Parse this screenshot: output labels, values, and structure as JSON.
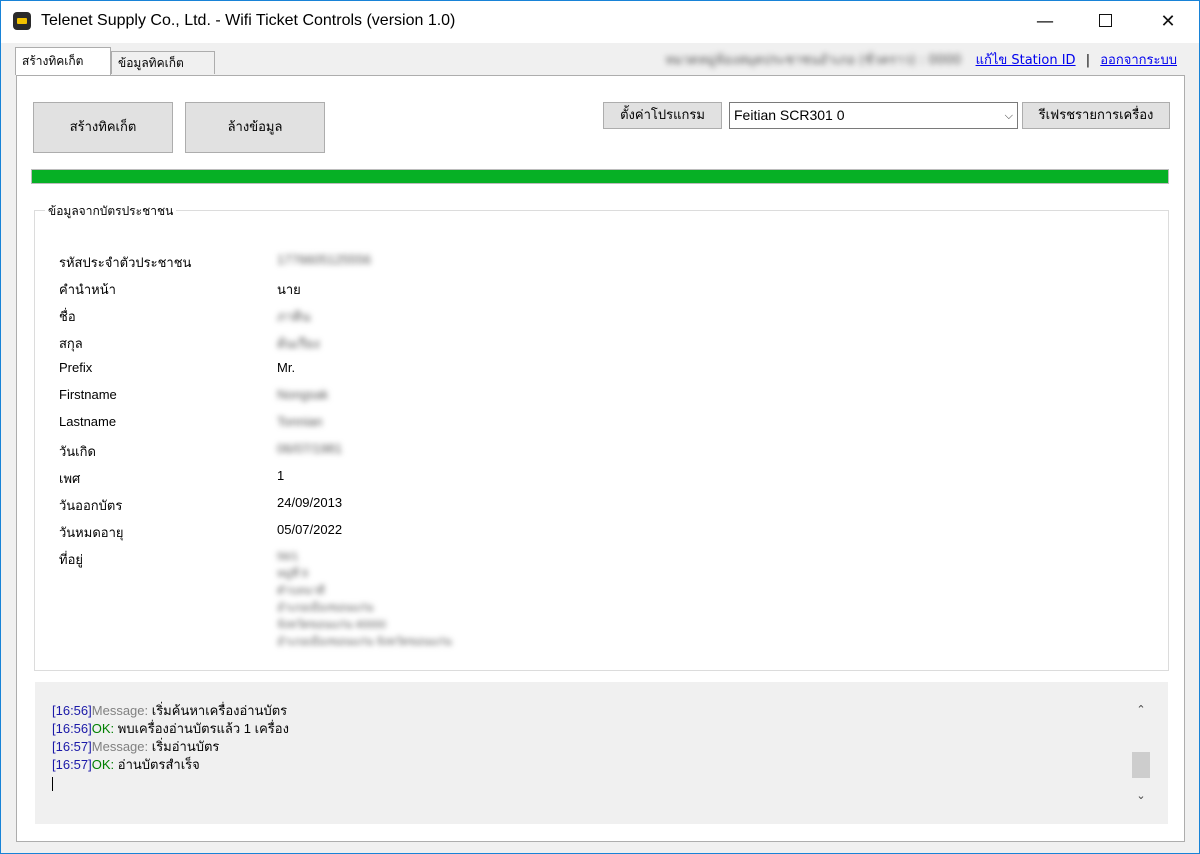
{
  "window": {
    "title": "Telenet Supply Co., Ltd. - Wifi Ticket Controls (version 1.0)",
    "icon": "card-reader-icon",
    "controls": {
      "minimize": "—",
      "maximize": "",
      "close": "✕"
    }
  },
  "tabs": [
    {
      "label": "สร้างทิคเก็ต",
      "active": true
    },
    {
      "label": "ข้อมูลทิคเก็ต",
      "active": false
    }
  ],
  "top_links": {
    "station_name": "หมวดหมู่ห้องสมุดประชาชนอำเภอ (ชั่วคราว) : 0000",
    "edit_station": "แก้ไข Station ID",
    "separator": "|",
    "logout": "ออกจากระบบ"
  },
  "actions": {
    "create_ticket": "สร้างทิคเก็ต",
    "clear_data": "ล้างข้อมูล",
    "program_settings": "ตั้งค่าโปรแกรม",
    "refresh_devices": "รีเฟรชรายการเครื่อง"
  },
  "reader_select": {
    "value": "Feitian SCR301 0",
    "arrow": "⌵"
  },
  "progress": {
    "fraction": 1.0,
    "color": "#06b025"
  },
  "card_info": {
    "title": "ข้อมูลจากบัตรประชาชน",
    "fields": [
      {
        "label": "รหัสประจำตัวประชาชน",
        "value": "1776605125556",
        "blurred": true
      },
      {
        "label": "คำนำหน้า",
        "value": "นาย",
        "blurred": false
      },
      {
        "label": "ชื่อ",
        "value": "ภาคิน",
        "blurred": true
      },
      {
        "label": "สกุล",
        "value": "ต้นเรียง",
        "blurred": true
      },
      {
        "label": "Prefix",
        "value": "Mr.",
        "blurred": false
      },
      {
        "label": "Firstname",
        "value": "Nongsak",
        "blurred": true
      },
      {
        "label": "Lastname",
        "value": "Tonnian",
        "blurred": true
      },
      {
        "label": "วันเกิด",
        "value": "06/07/1981",
        "blurred": true
      },
      {
        "label": "เพศ",
        "value": "1",
        "blurred": false
      },
      {
        "label": "วันออกบัตร",
        "value": "24/09/2013",
        "blurred": false
      },
      {
        "label": "วันหมดอายุ",
        "value": "05/07/2022",
        "blurred": false
      },
      {
        "label": "ที่อยู่",
        "value": "",
        "blurred": false
      }
    ],
    "address_lines": [
      "56/1",
      "หมู่ที่ 9",
      "ตำบลนาดี",
      "อำเภอเมืองขอนแก่น",
      "จังหวัดขอนแก่น 40000",
      "อำเภอเมืองขอนแก่น จังหวัดขอนแก่น"
    ]
  },
  "log": [
    {
      "time": "[16:56]",
      "type": "Message:",
      "kind": "msg",
      "text": " เริ่มค้นหาเครื่องอ่านบัตร"
    },
    {
      "time": "[16:56]",
      "type": "OK:",
      "kind": "ok",
      "text": " พบเครื่องอ่านบัตรแล้ว 1 เครื่อง"
    },
    {
      "time": "[16:57]",
      "type": "Message:",
      "kind": "msg",
      "text": " เริ่มอ่านบัตร"
    },
    {
      "time": "[16:57]",
      "type": "OK:",
      "kind": "ok",
      "text": " อ่านบัตรสำเร็จ"
    }
  ],
  "scroll": {
    "up": "⌃",
    "down": "⌄"
  }
}
